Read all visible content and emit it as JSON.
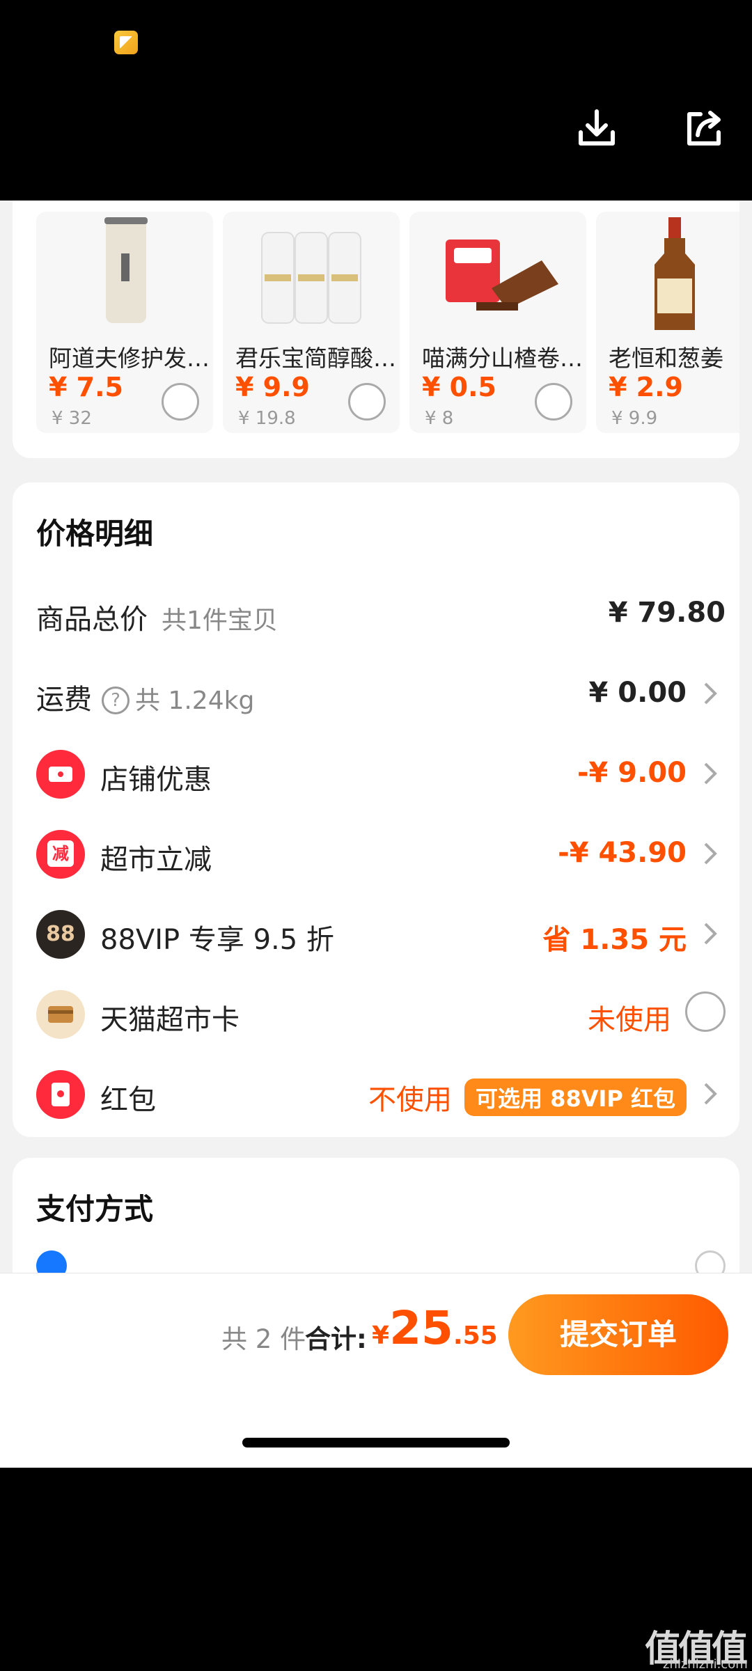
{
  "viewer": {
    "icons": [
      "note-icon",
      "download-icon",
      "share-icon"
    ]
  },
  "recommendations": [
    {
      "name": "阿道夫修护发…",
      "price": "¥ 7.5",
      "original": "¥ 32"
    },
    {
      "name": "君乐宝简醇酸…",
      "price": "¥ 9.9",
      "original": "¥ 19.8"
    },
    {
      "name": "喵满分山楂卷…",
      "price": "¥ 0.5",
      "original": "¥ 8"
    },
    {
      "name": "老恒和葱姜",
      "price": "¥ 2.9",
      "original": "¥ 9.9"
    }
  ],
  "price_detail": {
    "title": "价格明细",
    "items_total": {
      "label": "商品总价",
      "sub": "共1件宝贝",
      "value": "¥ 79.80"
    },
    "shipping": {
      "label": "运费",
      "sub": "共 1.24kg",
      "value": "¥ 0.00"
    },
    "store_discount": {
      "label": "店铺优惠",
      "value": "-¥ 9.00"
    },
    "supermarket_discount": {
      "label": "超市立减",
      "icon_text": "减",
      "value": "-¥ 43.90"
    },
    "vip": {
      "label": "88VIP 专享 9.5 折",
      "icon_text": "88",
      "value": "省 1.35 元"
    },
    "tmall_card": {
      "label": "天猫超市卡",
      "value": "未使用"
    },
    "red_packet": {
      "label": "红包",
      "value": "不使用",
      "tag": "可选用 88VIP 红包"
    }
  },
  "payment": {
    "title": "支付方式"
  },
  "checkout": {
    "count": "共 2 件",
    "total_label": "合计:",
    "currency": "¥",
    "total_int": "25",
    "total_dec": ".55",
    "submit": "提交订单"
  },
  "colors": {
    "accent": "#ff5000",
    "button_start": "#ff9a1f",
    "button_end": "#ff5a00",
    "vip_pill": "#ff8a1a"
  },
  "watermark": {
    "logo": "值值值",
    "url": "zhizhizhi.com"
  }
}
